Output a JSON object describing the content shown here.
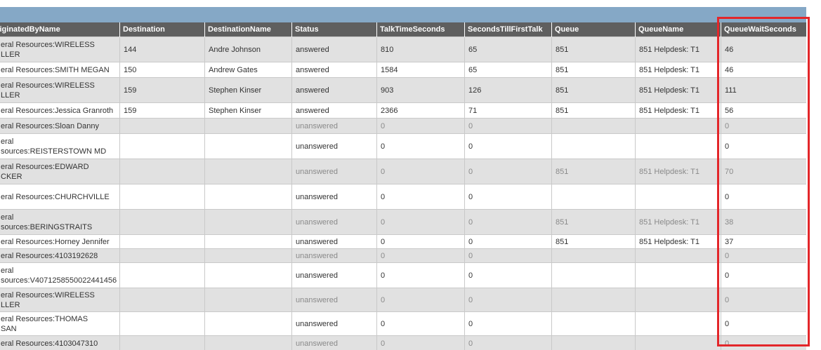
{
  "columns": [
    "iginatedByName",
    "Destination",
    "DestinationName",
    "Status",
    "TalkTimeSeconds",
    "SecondsTillFirstTalk",
    "Queue",
    "QueueName",
    "QueueWaitSeconds"
  ],
  "rows": [
    {
      "h": 36,
      "dim": false,
      "c": [
        "eral Resources:WIRELESS\nLLER",
        "144",
        "Andre Johnson",
        "answered",
        "810",
        "65",
        "851",
        "851 Helpdesk: T1",
        "46"
      ]
    },
    {
      "h": 22,
      "dim": false,
      "c": [
        "eral Resources:SMITH MEGAN",
        "150",
        "Andrew Gates",
        "answered",
        "1584",
        "65",
        "851",
        "851 Helpdesk: T1",
        "46"
      ]
    },
    {
      "h": 36,
      "dim": false,
      "c": [
        "eral Resources:WIRELESS\nLLER",
        "159",
        "Stephen Kinser",
        "answered",
        "903",
        "126",
        "851",
        "851 Helpdesk: T1",
        "111"
      ]
    },
    {
      "h": 22,
      "dim": false,
      "c": [
        "eral Resources:Jessica Granroth",
        "159",
        "Stephen Kinser",
        "answered",
        "2366",
        "71",
        "851",
        "851 Helpdesk: T1",
        "56"
      ]
    },
    {
      "h": 22,
      "dim": true,
      "c": [
        "eral Resources:Sloan Danny",
        "",
        "",
        "unanswered",
        "0",
        "0",
        "",
        "",
        "0"
      ]
    },
    {
      "h": 36,
      "dim": false,
      "c": [
        "eral\nsources:REISTERSTOWN MD",
        "",
        "",
        "unanswered",
        "0",
        "0",
        "",
        "",
        "0"
      ]
    },
    {
      "h": 36,
      "dim": true,
      "c": [
        "eral Resources:EDWARD\nCKER",
        "",
        "",
        "unanswered",
        "0",
        "0",
        "851",
        "851 Helpdesk: T1",
        "70"
      ]
    },
    {
      "h": 36,
      "dim": false,
      "c": [
        "eral Resources:CHURCHVILLE\n ",
        "",
        "",
        "unanswered",
        "0",
        "0",
        "",
        "",
        "0"
      ]
    },
    {
      "h": 36,
      "dim": true,
      "c": [
        "eral\nsources:BERINGSTRAITS",
        "",
        "",
        "unanswered",
        "0",
        "0",
        "851",
        "851 Helpdesk: T1",
        "38"
      ]
    },
    {
      "h": 20,
      "dim": false,
      "c": [
        "eral Resources:Horney Jennifer",
        "",
        "",
        "unanswered",
        "0",
        "0",
        "851",
        "851 Helpdesk: T1",
        "37"
      ]
    },
    {
      "h": 20,
      "dim": true,
      "c": [
        "eral Resources:4103192628",
        "",
        "",
        "unanswered",
        "0",
        "0",
        "",
        "",
        "0"
      ]
    },
    {
      "h": 36,
      "dim": false,
      "c": [
        "eral\nsources:V4071258550022441456",
        "",
        "",
        "unanswered",
        "0",
        "0",
        "",
        "",
        "0"
      ]
    },
    {
      "h": 34,
      "dim": true,
      "c": [
        "eral Resources:WIRELESS\nLLER",
        "",
        "",
        "unanswered",
        "0",
        "0",
        "",
        "",
        "0"
      ]
    },
    {
      "h": 34,
      "dim": false,
      "c": [
        "eral Resources:THOMAS\nSAN",
        "",
        "",
        "unanswered",
        "0",
        "0",
        "",
        "",
        "0"
      ]
    },
    {
      "h": 22,
      "dim": true,
      "c": [
        "eral Resources:4103047310",
        "",
        "",
        "unanswered",
        "0",
        "0",
        "",
        "",
        "0"
      ]
    }
  ]
}
